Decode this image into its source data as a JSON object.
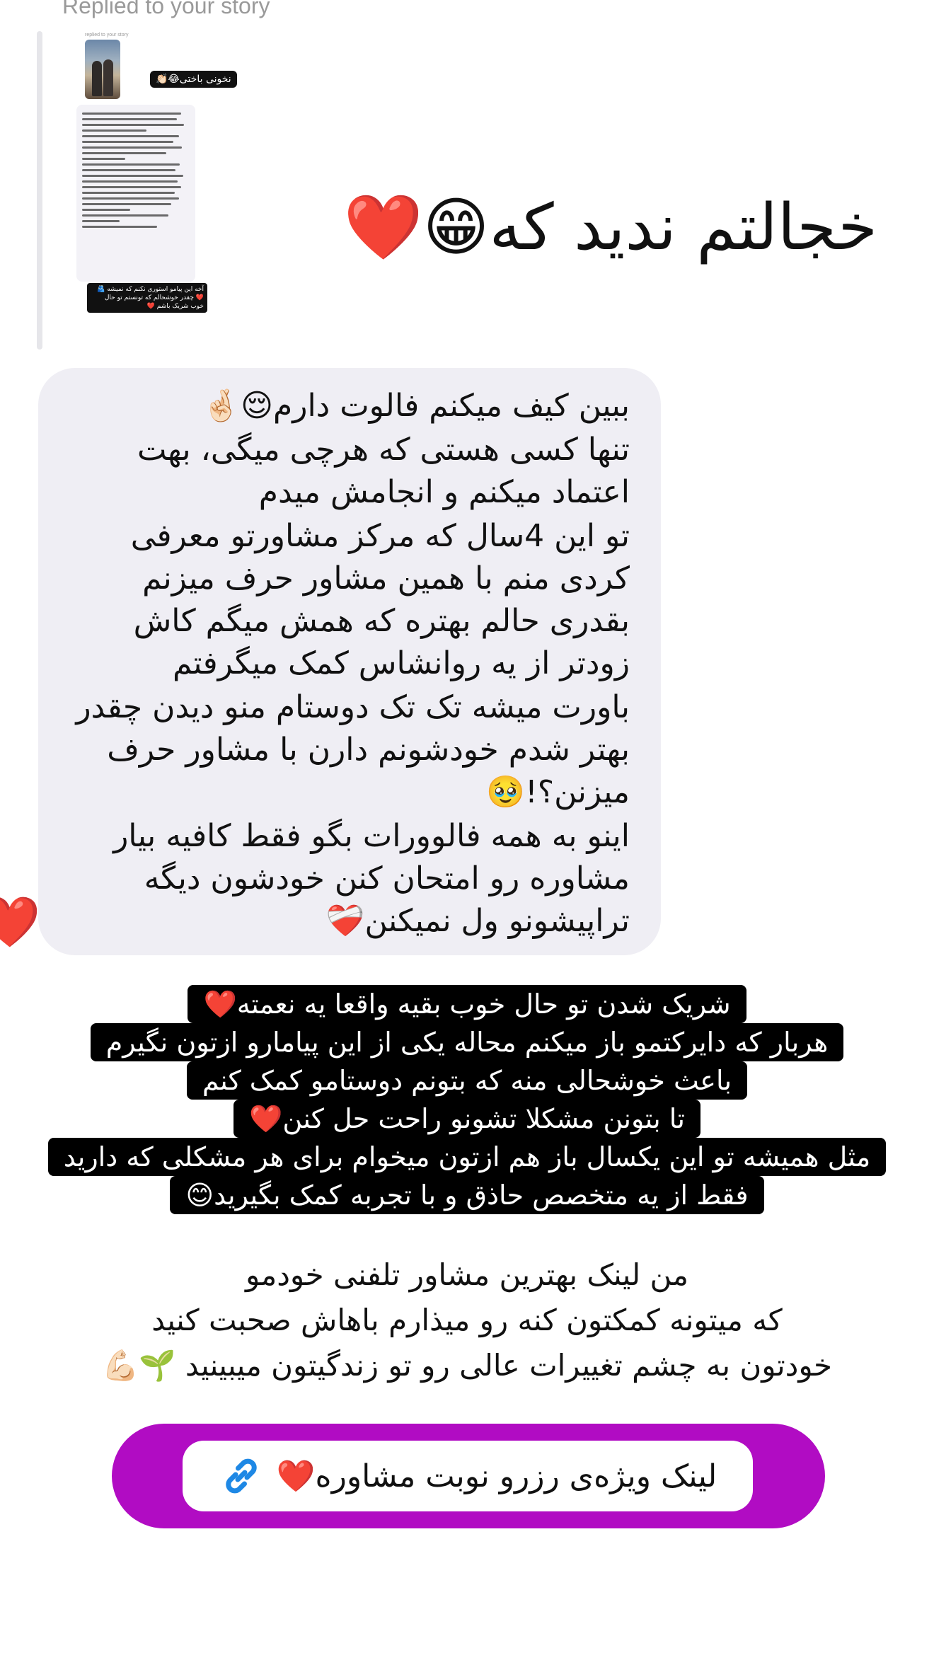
{
  "header": {
    "replied_label": "Replied to your story"
  },
  "story_preview": {
    "tiny_header": "replied to your story",
    "tag": "نخونی باختی😂👏🏻",
    "caption": "آخه این پیامو استوری نکنم که نمیشه 🫂❤️ چقدر خوشحالم که تونستم تو حال خوب شریک باشم ❤️"
  },
  "reply": {
    "text": "خجالتم ندید که😁❤️"
  },
  "message": {
    "paragraphs": [
      "ببین کیف میکنم فالوت دارم😌🤞🏻",
      "تنها کسی هستی که هرچی میگی، بهت اعتماد میکنم و انجامش میدم",
      "تو این 4سال که مرکز مشاورتو معرفی کردی منم با همین مشاور حرف میزنم بقدری حالم بهتره که همش میگم کاش زودتر از یه روانشاس کمک میگرفتم",
      "باورت میشه  تک تک دوستام منو دیدن چقدر بهتر شدم خودشونم دارن با مشاور حرف میزنن؟!🥹",
      "اینو به همه فالوورات بگو فقط کافیه بیار مشاوره رو امتحان کنن خودشون دیگه تراپیشونو ول نمیکنن❤️‍🩹"
    ],
    "reaction": "❤️"
  },
  "story_highlight": {
    "lines": [
      "شریک شدن تو حال خوب بقیه واقعا یه نعمته❤️",
      "هربار که دایرکتمو باز میکنم محاله یکی از این پیامارو ازتون نگیرم",
      "باعث خوشحالی منه که بتونم دوستامو کمک کنم",
      "تا بتونن مشکلا تشونو راحت حل کنن❤️",
      "مثل همیشه تو این یکسال باز هم ازتون میخوام برای هر مشکلی که دارید",
      "فقط از یه متخصص حاذق و با تجربه کمک بگیرید😊"
    ]
  },
  "story_plain": {
    "lines": [
      "من لینک بهترین مشاور تلفنی خودمو",
      "که میتونه کمکتون کنه رو میذارم باهاش صحبت کنید",
      "خودتون به چشم تغییرات عالی رو تو زندگیتون میبینید 🌱💪🏻"
    ]
  },
  "booking_link": {
    "label": "لینک ویژه‌ی رزرو نوبت مشاوره❤️",
    "icon": "link-icon",
    "colors": {
      "outer": "#b10cc3",
      "icon": "#1e88e5"
    }
  }
}
